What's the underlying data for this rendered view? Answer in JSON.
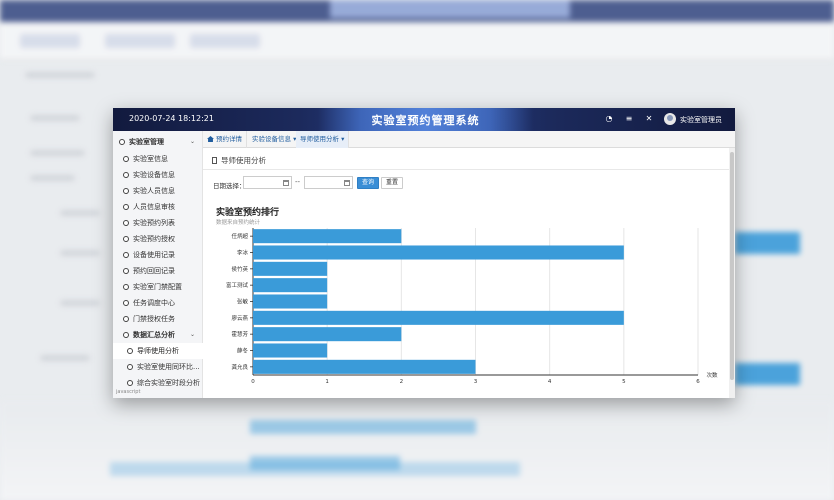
{
  "header": {
    "datetime": "2020-07-24 18:12:21",
    "title": "实验室预约管理系统",
    "icons": [
      "dashboard-icon",
      "menu-icon",
      "fullscreen-icon"
    ],
    "user": "实验室管理员"
  },
  "sidebar": {
    "group1": {
      "label": "实验室管理",
      "items": [
        "实验室信息",
        "实验设备信息",
        "实验人员信息",
        "人员信息审核",
        "实验预约列表",
        "实验预约授权",
        "设备使用记录",
        "预约回回记录",
        "实验室门禁配置",
        "任务调度中心",
        "门禁授权任务"
      ]
    },
    "group2": {
      "label": "数据汇总分析",
      "items": [
        "导师使用分析",
        "实验室使用同环比...",
        "综合实验室时段分析"
      ]
    },
    "footer": "javascript"
  },
  "tabs": [
    {
      "label": "预约详情",
      "icon": "home-icon"
    },
    {
      "label": "实验设备信息 ▾"
    },
    {
      "label": "导师使用分析 ▾",
      "active": true
    }
  ],
  "page": {
    "heading": "导师使用分析",
    "filter_label": "日期选择：",
    "range_separator": "--",
    "query_button": "查询",
    "reset_button": "重置"
  },
  "chart_data": {
    "type": "bar",
    "orientation": "horizontal",
    "title": "实验室预约排行",
    "subtitle": "数据来自预约统计",
    "categories": [
      "任炳超",
      "李冰",
      "侯竹英",
      "富工测试",
      "张敏",
      "廖云燕",
      "霍慧芳",
      "薛冬",
      "龚允良"
    ],
    "values": [
      2,
      5,
      1,
      1,
      1,
      5,
      2,
      1,
      3
    ],
    "xlabel": "次数",
    "xlim": [
      0,
      6
    ],
    "xticks": [
      "0",
      "1",
      "2",
      "3",
      "4",
      "5",
      "6"
    ],
    "grid": true,
    "colors": {
      "bar": "#3a9bd9",
      "grid": "#e6e6e6",
      "axis": "#333333"
    }
  }
}
